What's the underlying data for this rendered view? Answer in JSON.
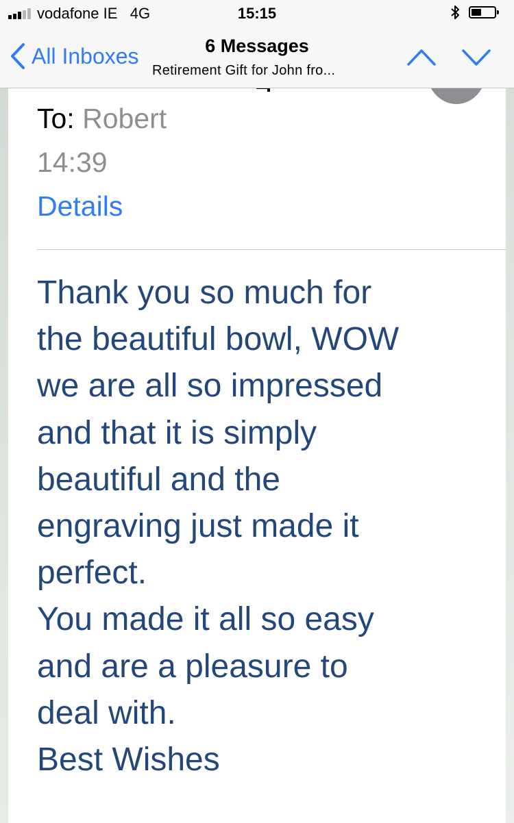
{
  "status_bar": {
    "carrier": "vodafone IE",
    "network": "4G",
    "time": "15:15",
    "bluetooth_icon": "bluetooth-icon",
    "battery_icon": "battery-icon",
    "signal_icon": "signal-bars-icon",
    "signal_bars_filled": 3,
    "signal_bars_total": 5,
    "battery_level": 0.45
  },
  "nav": {
    "back_label": "All Inboxes",
    "title": "6 Messages",
    "subtitle": "Retirement Gift for John fro...",
    "up_icon": "chevron-up-icon",
    "down_icon": "chevron-down-icon"
  },
  "message": {
    "to_label": "To:",
    "to_value": "Robert",
    "time": "14:39",
    "details_link": "Details",
    "body_lines": [
      "Thank you so much for",
      "the beautiful bowl, WOW",
      "we are all so impressed",
      "and that it is simply",
      "beautiful and the",
      "engraving just made it",
      "perfect.",
      "You made it all so easy",
      "and are a pleasure to",
      "deal with.",
      "Best Wishes"
    ]
  },
  "colors": {
    "accent": "#2f7cf6",
    "body_text": "#23477a",
    "secondary_text": "#8e8e93",
    "bar_background": "#f7f7f7"
  }
}
